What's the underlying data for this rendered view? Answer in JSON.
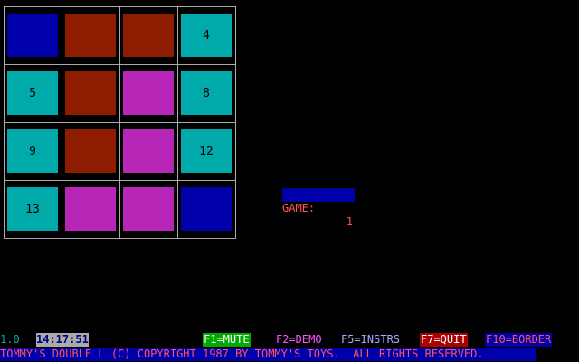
{
  "board": {
    "rows": [
      [
        {
          "label": "",
          "color": "blue"
        },
        {
          "label": "",
          "color": "brown"
        },
        {
          "label": "",
          "color": "brown"
        },
        {
          "label": "4",
          "color": "cyan"
        }
      ],
      [
        {
          "label": "5",
          "color": "cyan"
        },
        {
          "label": "",
          "color": "brown"
        },
        {
          "label": "",
          "color": "purple"
        },
        {
          "label": "8",
          "color": "cyan"
        }
      ],
      [
        {
          "label": "9",
          "color": "cyan"
        },
        {
          "label": "",
          "color": "brown"
        },
        {
          "label": "",
          "color": "purple"
        },
        {
          "label": "12",
          "color": "cyan"
        }
      ],
      [
        {
          "label": "13",
          "color": "cyan"
        },
        {
          "label": "",
          "color": "purple"
        },
        {
          "label": "",
          "color": "purple"
        },
        {
          "label": "",
          "color": "blue"
        }
      ]
    ]
  },
  "game": {
    "label": "GAME:",
    "value": "1"
  },
  "status": {
    "version": "1.0",
    "clock": "14:17:51",
    "keys": [
      {
        "label": "F1=MUTE",
        "fg": "#ffffff",
        "bg": "#00aa00"
      },
      {
        "label": "F2=DEMO",
        "fg": "#ff55ff",
        "bg": ""
      },
      {
        "label": "F5=INSTRS",
        "fg": "#aaaaff",
        "bg": ""
      },
      {
        "label": "F7=QUIT",
        "fg": "#ffffff",
        "bg": "#aa0000"
      },
      {
        "label": "F10=BORDER",
        "fg": "#ff5555",
        "bg": "#0000aa"
      }
    ]
  },
  "copyright": "TOMMY'S DOUBLE L (C) COPYRIGHT 1987 BY TOMMY'S TOYS.  ALL RIGHTS RESERVED.",
  "colors": {
    "cyan_tile": "#00aaaa",
    "blue_tile": "#0000aa",
    "brown_tile": "#aa2200",
    "purple_tile": "#dd33dd",
    "grid": "#aaaaaa",
    "version_text": "#00aaaa",
    "clock_bg": "#aaaaaa",
    "clock_fg": "#000080"
  }
}
